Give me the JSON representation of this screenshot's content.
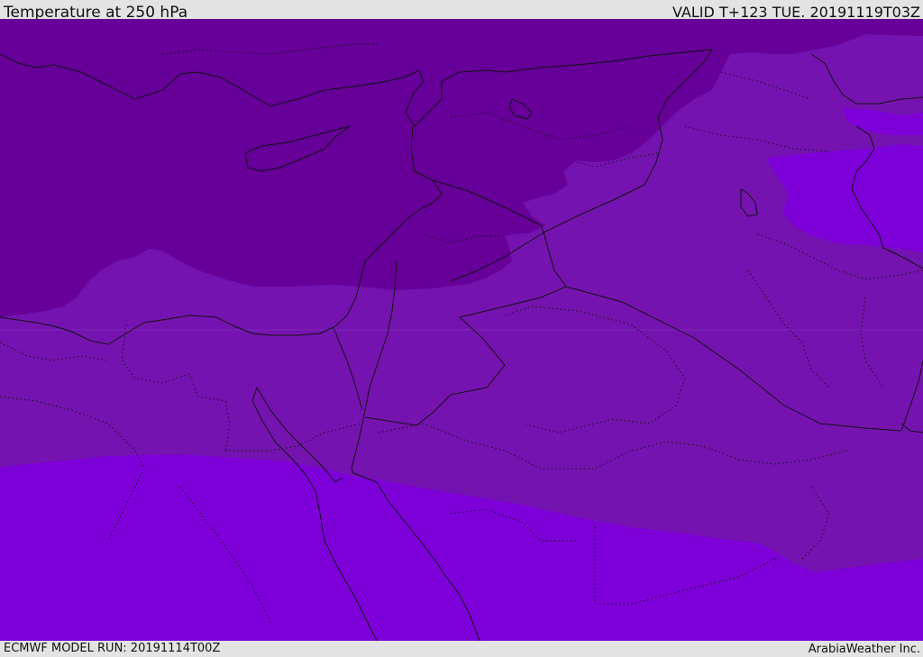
{
  "header": {
    "title": "Temperature at 250 hPa",
    "valid": "VALID T+123 TUE. 20191119T03Z"
  },
  "footer": {
    "model_run": "ECMWF MODEL RUN: 20191114T00Z",
    "credit": "ArabiaWeather Inc."
  },
  "colors": {
    "coldest": "#660099",
    "cold": "#7513b0",
    "warm": "#7d00d9",
    "border": "#111111"
  }
}
